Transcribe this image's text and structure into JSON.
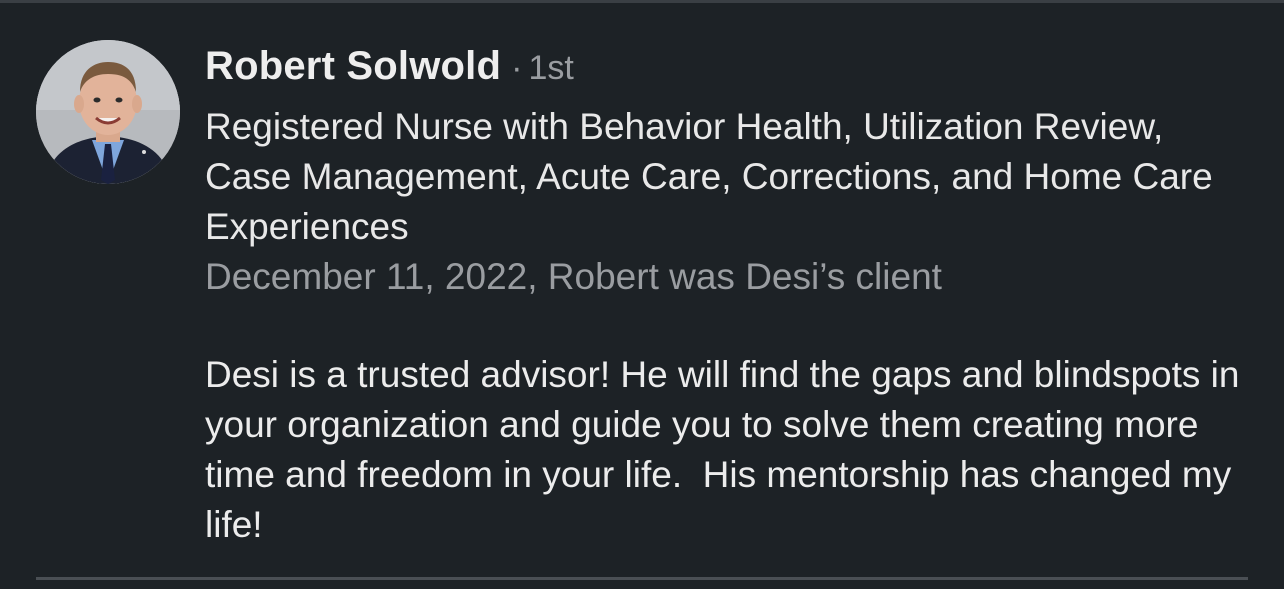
{
  "recommendation": {
    "author_name": "Robert Solwold",
    "separator": "·",
    "connection_degree": "1st",
    "headline": "Registered Nurse with Behavior Health, Utilization Review, Case Management, Acute Care, Corrections, and Home Care Experiences",
    "meta": "December 11, 2022, Robert was Desi’s client",
    "text": "Desi is a trusted advisor! He will find the gaps and blindspots in your organization and guide you to solve them creating more time and freedom in your life.  His mentorship has changed my life!"
  },
  "colors": {
    "background": "#1d2226",
    "primary_text": "#e9e9e9",
    "secondary_text": "#9a9da1",
    "divider": "#4a4f54"
  }
}
